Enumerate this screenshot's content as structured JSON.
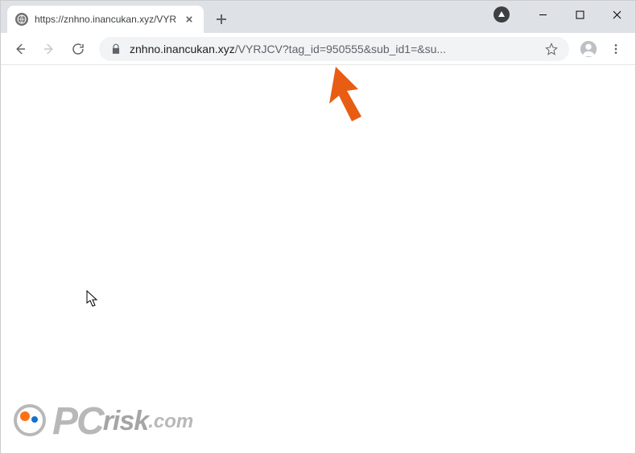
{
  "tab": {
    "title": "https://znhno.inancukan.xyz/VYR"
  },
  "addressBar": {
    "host": "znhno.inancukan.xyz",
    "path": "/VYRJCV?tag_id=950555&sub_id1=&su..."
  },
  "watermark": {
    "pc": "PC",
    "risk": "risk",
    "com": ".com"
  }
}
